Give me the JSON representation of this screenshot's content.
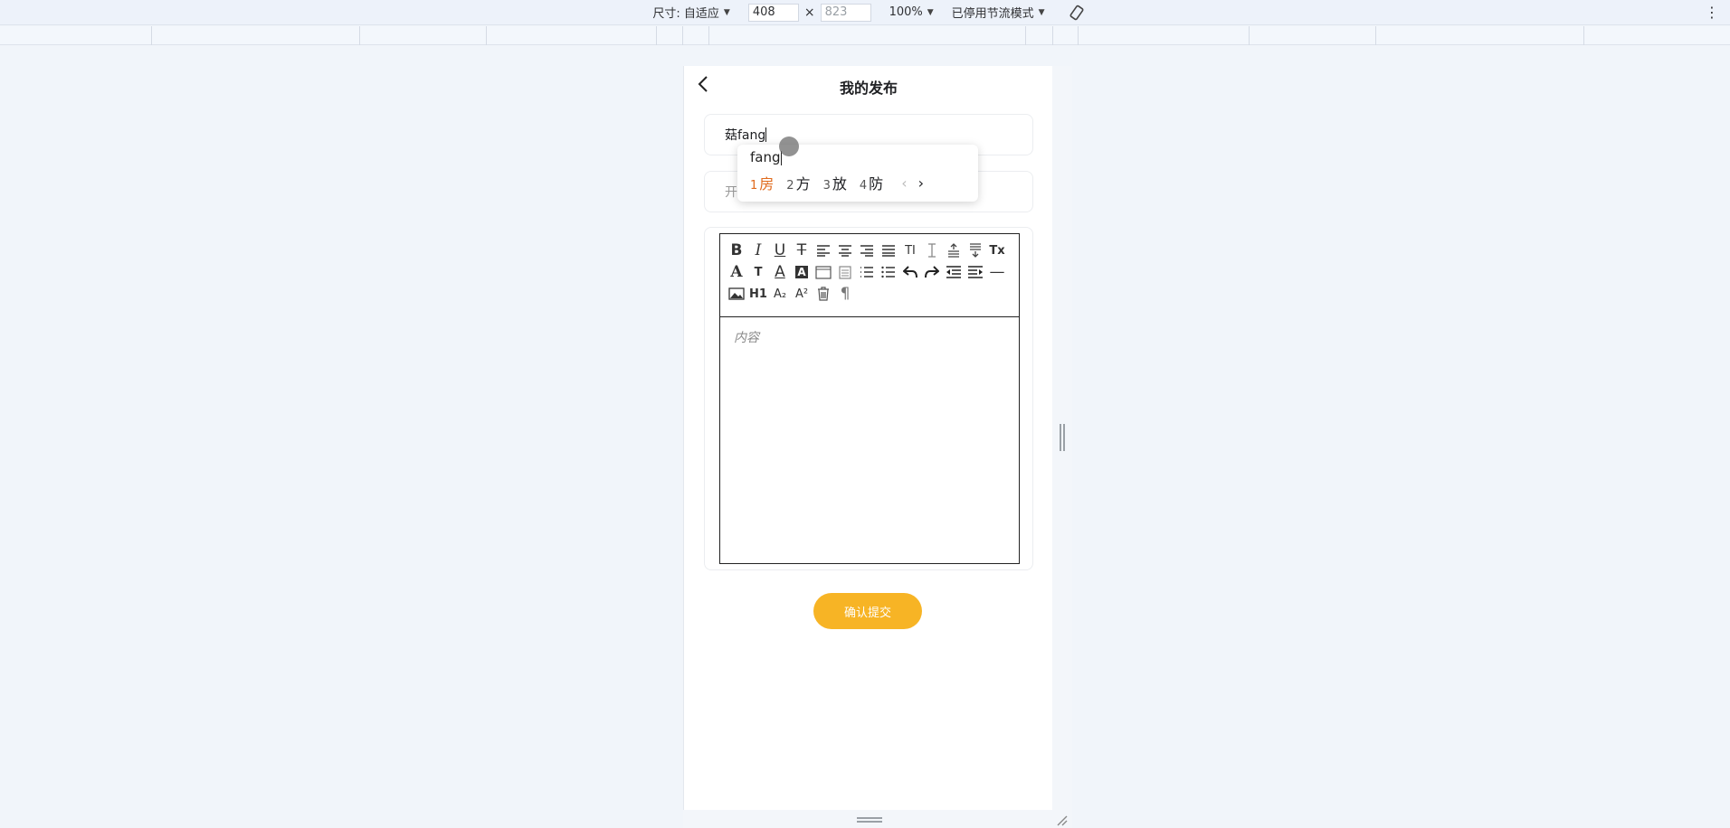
{
  "devtools": {
    "size_label": "尺寸: 自适应",
    "width": "408",
    "height": "823",
    "zoom": "100%",
    "throttle": "已停用节流模式",
    "times": "×"
  },
  "page": {
    "title": "我的发布",
    "title_field_value": "菇fang",
    "second_field_placeholder": "开放",
    "content_placeholder": "内容",
    "submit_label": "确认提交"
  },
  "ime": {
    "composition": "fang",
    "candidates": [
      {
        "num": "1",
        "text": "房"
      },
      {
        "num": "2",
        "text": "方"
      },
      {
        "num": "3",
        "text": "放"
      },
      {
        "num": "4",
        "text": "防"
      }
    ],
    "prev": "‹",
    "next": "›"
  },
  "toolbar_icons": {
    "bold": "B",
    "italic": "I",
    "underline": "U",
    "strike": "T",
    "font": "A",
    "h1": "H1",
    "paragraph": "¶",
    "size": "T",
    "color": "A",
    "bg": "A",
    "sub": "A₂",
    "sup": "A²",
    "clear": "Tx",
    "textsize": "TI",
    "hr": "—"
  },
  "colors": {
    "accent": "#f7b425",
    "ime_active": "#e06a1c"
  }
}
